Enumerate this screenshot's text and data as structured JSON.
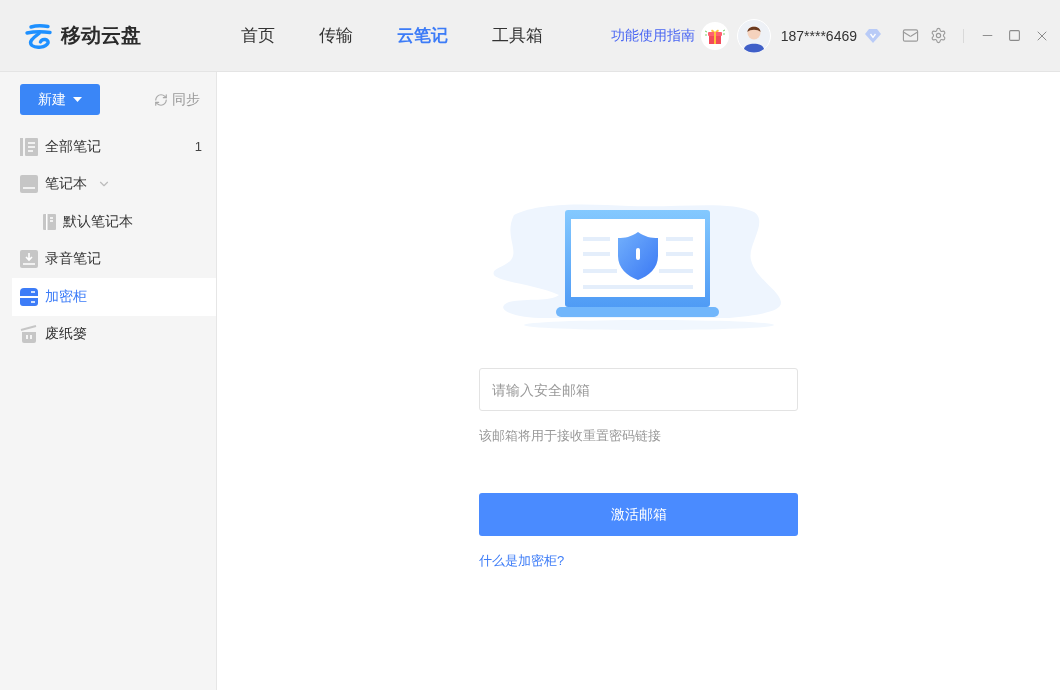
{
  "app": {
    "name": "移动云盘"
  },
  "nav_tabs": [
    {
      "label": "首页",
      "selected": false
    },
    {
      "label": "传输",
      "selected": false
    },
    {
      "label": "云笔记",
      "selected": true
    },
    {
      "label": "工具箱",
      "selected": false
    }
  ],
  "header": {
    "guide_link": "功能使用指南",
    "phone": "187****6469"
  },
  "sidebar": {
    "new_button": "新建",
    "sync_button": "同步",
    "items": [
      {
        "label": "全部笔记",
        "count": "1",
        "selected": false
      },
      {
        "label": "笔记本",
        "expanded": true,
        "selected": false,
        "children": [
          {
            "label": "默认笔记本",
            "selected": false
          }
        ]
      },
      {
        "label": "录音笔记",
        "selected": false
      },
      {
        "label": "加密柜",
        "selected": true
      },
      {
        "label": "废纸篓",
        "selected": false
      }
    ]
  },
  "vault": {
    "email_field": {
      "placeholder": "请输入安全邮箱"
    },
    "hint": "该邮箱将用于接收重置密码链接",
    "activate_button": "激活邮箱",
    "help_link": "什么是加密柜?"
  }
}
